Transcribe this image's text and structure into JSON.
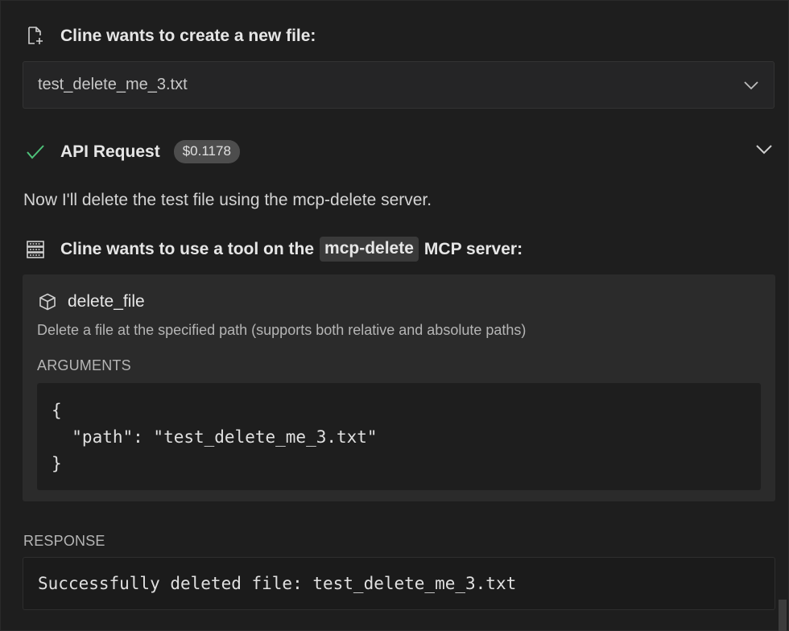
{
  "create_file": {
    "header": "Cline wants to create a new file:",
    "icon": "new-file-icon",
    "filename": "test_delete_me_3.txt",
    "expand_icon": "chevron-down-icon"
  },
  "api_request": {
    "label": "API Request",
    "cost": "$0.1178",
    "status_icon": "check-icon",
    "status_color": "#4ec27a",
    "expand_icon": "chevron-down-icon"
  },
  "message": "Now I'll delete the test file using the mcp-delete server.",
  "mcp_use": {
    "prefix": "Cline wants to use a tool on the",
    "server": "mcp-delete",
    "suffix": "MCP server:",
    "icon": "server-icon"
  },
  "tool": {
    "name": "delete_file",
    "icon": "cube-icon",
    "description": "Delete a file at the specified path (supports both relative and absolute paths)",
    "arguments_label": "ARGUMENTS",
    "arguments_lines": [
      "{",
      "  \"path\": \"test_delete_me_3.txt\"",
      "}"
    ]
  },
  "response": {
    "label": "RESPONSE",
    "text": "Successfully deleted file: test_delete_me_3.txt"
  }
}
